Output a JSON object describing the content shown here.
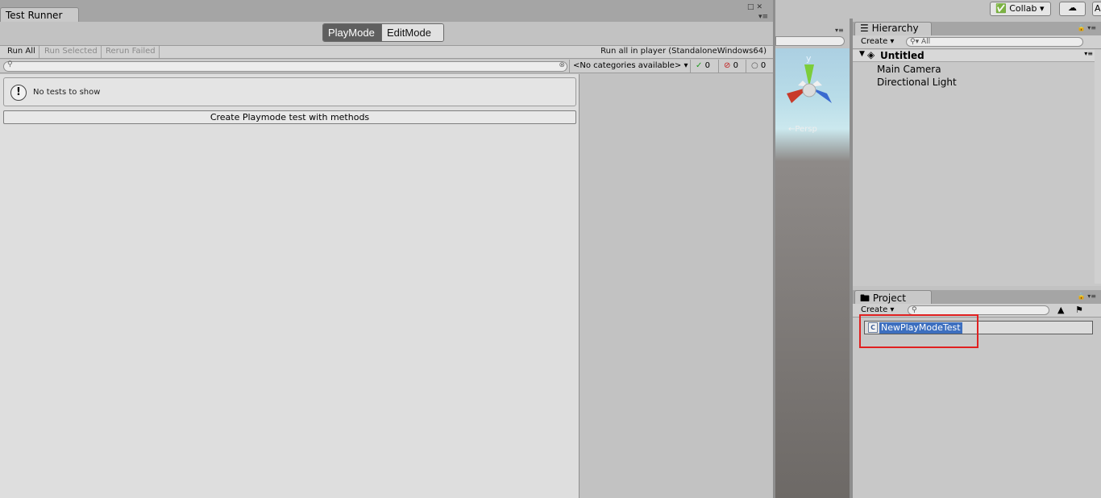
{
  "test_runner": {
    "tab_title": "Test Runner",
    "modes": {
      "playmode": "PlayMode",
      "editmode": "EditMode",
      "active": "PlayMode"
    },
    "toolbar": {
      "run_all": "Run All",
      "run_selected": "Run Selected",
      "rerun_failed": "Rerun Failed",
      "run_in_player": "Run all in player (StandaloneWindows64)"
    },
    "filter": {
      "search_value": "",
      "categories": "<No categories available>",
      "passed_count": "0",
      "failed_count": "0",
      "not_run_count": "0"
    },
    "empty_message": "No tests to show",
    "create_button": "Create Playmode test with methods"
  },
  "scene": {
    "axis_label": "y",
    "projection_label": "←Persp"
  },
  "top_toolbar": {
    "collab_label": "Collab",
    "account_label": "A"
  },
  "hierarchy": {
    "tab_title": "Hierarchy",
    "create_label": "Create",
    "search_placeholder": "All",
    "scene_name": "Untitled",
    "items": [
      "Main Camera",
      "Directional Light"
    ]
  },
  "project": {
    "tab_title": "Project",
    "create_label": "Create",
    "search_value": "",
    "new_asset_name": "NewPlayModeTest"
  },
  "colors": {
    "selection_blue": "#3d6fbf",
    "highlight_red": "#e02020",
    "pass_green": "#1e9a1e",
    "fail_red": "#c01a1a"
  }
}
